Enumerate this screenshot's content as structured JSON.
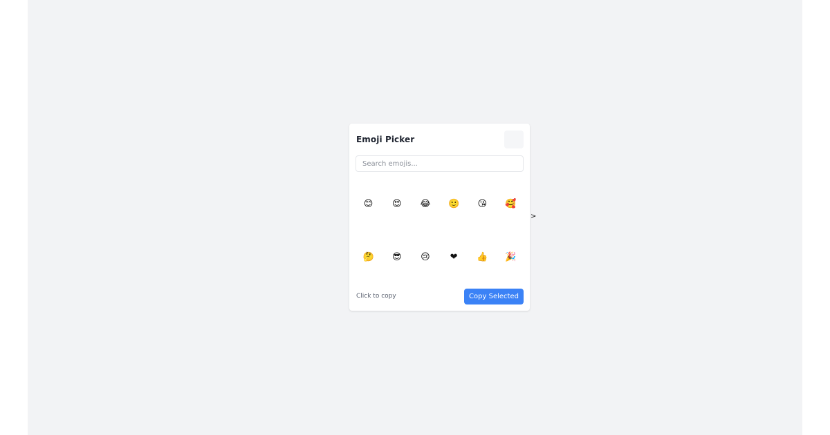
{
  "picker": {
    "title": "Emoji Picker",
    "search_placeholder": "Search emojis...",
    "emojis": [
      {
        "char": "😊",
        "name": "smiling-face-emoji"
      },
      {
        "char": "😍",
        "name": "heart-eyes-emoji"
      },
      {
        "char": "😂",
        "name": "tears-of-joy-emoji"
      },
      {
        "char": "🙂",
        "name": "slight-smile-emoji"
      },
      {
        "char": "😘",
        "name": "blowing-kiss-emoji"
      },
      {
        "char": "🥰",
        "name": "smiling-hearts-emoji"
      },
      {
        "char": "🤔",
        "name": "thinking-face-emoji"
      },
      {
        "char": "😎",
        "name": "sunglasses-emoji"
      },
      {
        "char": "😢",
        "name": "crying-face-emoji"
      },
      {
        "char": "❤",
        "name": "red-heart-emoji"
      },
      {
        "char": "👍",
        "name": "thumbs-up-emoji"
      },
      {
        "char": "🎉",
        "name": "party-popper-emoji"
      }
    ],
    "hint": "Click to copy",
    "copy_label": "Copy Selected",
    "accent_color": "#3b82f6"
  },
  "stray_text": ">"
}
